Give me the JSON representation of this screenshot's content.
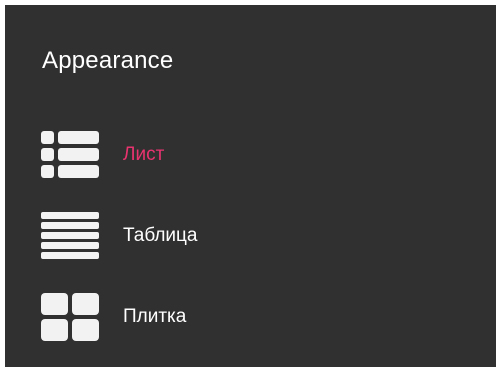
{
  "dialog": {
    "title": "Appearance"
  },
  "options": [
    {
      "label": "Лист",
      "icon": "list-view-icon",
      "selected": true
    },
    {
      "label": "Таблица",
      "icon": "table-view-icon",
      "selected": false
    },
    {
      "label": "Плитка",
      "icon": "tile-view-icon",
      "selected": false
    }
  ],
  "colors": {
    "background": "#303030",
    "text": "#ffffff",
    "accent": "#e8336f",
    "icon": "#f2f2f2"
  }
}
